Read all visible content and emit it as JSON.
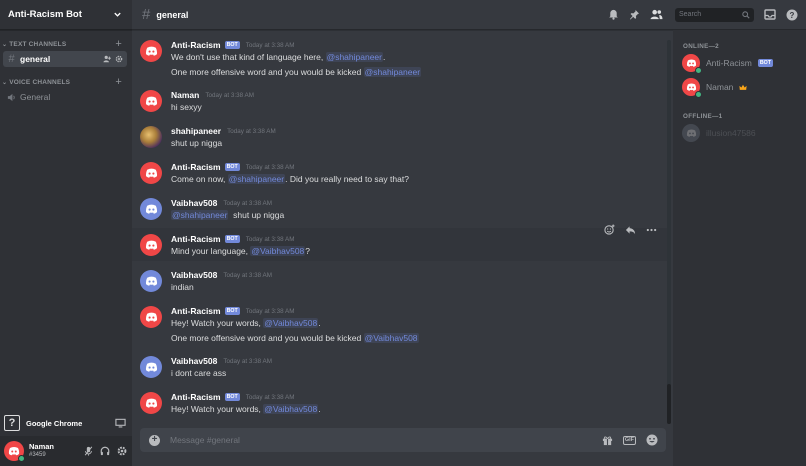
{
  "server": {
    "name": "Anti-Racism Bot"
  },
  "sidebar": {
    "text_category": "TEXT CHANNELS",
    "voice_category": "VOICE CHANNELS",
    "text_channels": [
      {
        "name": "general"
      }
    ],
    "voice_channels": [
      {
        "name": "General"
      }
    ]
  },
  "activity": {
    "app_name": "Google Chrome"
  },
  "user": {
    "name": "Naman",
    "tag": "#3459"
  },
  "header": {
    "channel": "general",
    "search_placeholder": "Search"
  },
  "messages": [
    {
      "author": "Anti-Racism",
      "bot": "BOT",
      "time": "Today at 3:38 AM",
      "line1": {
        "text": "We don't use that kind of language here, ",
        "mention": "@shahipaneer",
        "after": "."
      },
      "line2": {
        "text": "One more offensive word and you would be kicked ",
        "mention": "@shahipaneer",
        "after": ""
      }
    },
    {
      "author": "Naman",
      "time": "Today at 3:38 AM",
      "text": "hi sexyy"
    },
    {
      "author": "shahipaneer",
      "time": "Today at 3:38 AM",
      "text": "shut up nigga"
    },
    {
      "author": "Anti-Racism",
      "bot": "BOT",
      "time": "Today at 3:38 AM",
      "line1": {
        "text": "Come on now, ",
        "mention": "@shahipaneer",
        "after": ". Did you really need to say that?"
      }
    },
    {
      "author": "Vaibhav508",
      "time": "Today at 3:38 AM",
      "line1": {
        "text": "",
        "mention": "@shahipaneer",
        "after": "  shut up nigga"
      }
    },
    {
      "author": "Anti-Racism",
      "bot": "BOT",
      "time": "Today at 3:38 AM",
      "line1": {
        "text": "Mind your language, ",
        "mention": "@Vaibhav508",
        "after": "?"
      }
    },
    {
      "author": "Vaibhav508",
      "time": "Today at 3:38 AM",
      "text": "indian"
    },
    {
      "author": "Anti-Racism",
      "bot": "BOT",
      "time": "Today at 3:38 AM",
      "line1": {
        "text": "Hey! Watch your words, ",
        "mention": "@Vaibhav508",
        "after": "."
      },
      "line2": {
        "text": "One more offensive word and you would be kicked ",
        "mention": "@Vaibhav508",
        "after": ""
      }
    },
    {
      "author": "Vaibhav508",
      "time": "Today at 3:38 AM",
      "text": "i dont care ass"
    },
    {
      "author": "Anti-Racism",
      "bot": "BOT",
      "time": "Today at 3:38 AM",
      "line1": {
        "text": "Hey! Watch your words, ",
        "mention": "@Vaibhav508",
        "after": "."
      }
    }
  ],
  "composer": {
    "placeholder": "Message #general",
    "gif_label": "GIF"
  },
  "members": {
    "online_header": "ONLINE—2",
    "offline_header": "OFFLINE—1",
    "online": [
      {
        "name": "Anti-Racism",
        "bot": "BOT"
      },
      {
        "name": "Naman"
      }
    ],
    "offline": [
      {
        "name": "illusion47586"
      }
    ]
  },
  "colors": {
    "accent": "#7289da",
    "bot_avatar": "#f04747",
    "online": "#43b581"
  }
}
